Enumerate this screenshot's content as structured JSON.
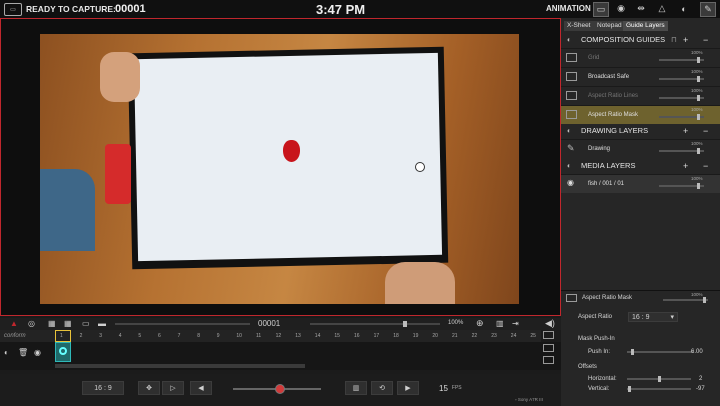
{
  "topbar": {
    "status": "READY TO CAPTURE:",
    "frame": "00001",
    "clock": "3:47 PM",
    "mode": "ANIMATION"
  },
  "right_panel": {
    "tabs": [
      "X-Sheet",
      "Notepad",
      "Guide Layers"
    ],
    "composition_guides": {
      "title": "COMPOSITION GUIDES",
      "layers": [
        {
          "name": "Grid",
          "opacity": "100%",
          "level": 0.9,
          "dim": true
        },
        {
          "name": "Broadcast Safe",
          "opacity": "100%",
          "level": 0.9,
          "dim": false
        },
        {
          "name": "Aspect Ratio Lines",
          "opacity": "100%",
          "level": 0.9,
          "dim": true
        },
        {
          "name": "Aspect Ratio Mask",
          "opacity": "100%",
          "level": 0.9,
          "dim": false
        }
      ]
    },
    "drawing_layers": {
      "title": "DRAWING LAYERS",
      "layers": [
        {
          "name": "Drawing",
          "opacity": "100%",
          "level": 0.9
        }
      ]
    },
    "media_layers": {
      "title": "MEDIA LAYERS",
      "layers": [
        {
          "name": "fish / 001 / 01",
          "opacity": "100%",
          "level": 0.9
        }
      ]
    },
    "properties": {
      "title": "Aspect Ratio Mask",
      "opacity": "100%",
      "aspect_ratio_label": "Aspect Ratio",
      "aspect_ratio_value": "16 : 9",
      "mask_push_in_title": "Mask Push-In",
      "push_in_label": "Push In:",
      "push_in_value": "6.00",
      "push_in_level": 0.06,
      "offsets_title": "Offsets",
      "horizontal_label": "Horizontal:",
      "horizontal_value": "2",
      "horizontal_level": 0.51,
      "vertical_label": "Vertical:",
      "vertical_value": "-97",
      "vertical_level": 0.02
    }
  },
  "controls": {
    "frame_field": "00001",
    "zoom": "100%",
    "layer_name": "conform"
  },
  "ruler_ticks": [
    "1",
    "2",
    "3",
    "4",
    "5",
    "6",
    "7",
    "8",
    "9",
    "10",
    "11",
    "12",
    "13",
    "14",
    "15",
    "16",
    "17",
    "18",
    "19",
    "20",
    "21",
    "22",
    "23",
    "24",
    "25"
  ],
  "bottom": {
    "aspect": "16 : 9",
    "fps_value": "15",
    "fps_unit": "FPS",
    "camera": "Sony A7R III"
  },
  "colors": {
    "accent_red": "#c0272d",
    "selection": "#6e622e",
    "playhead": "#e8c23a",
    "record": "#d23a3a"
  },
  "icons": [
    "app-logo-icon",
    "monitor-icon",
    "camera-icon",
    "sliders-icon",
    "shapes-icon",
    "guides-icon",
    "pen-icon"
  ]
}
